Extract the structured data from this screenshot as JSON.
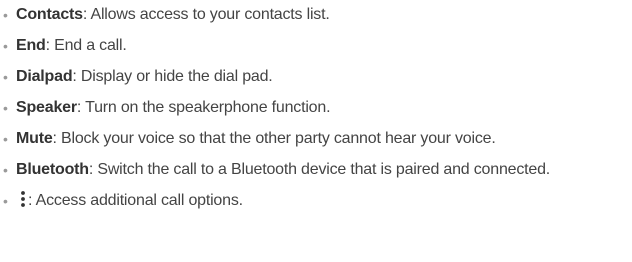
{
  "items": [
    {
      "term": "Contacts",
      "desc": "Allows access to your contacts list."
    },
    {
      "term": "End",
      "desc": "End a call."
    },
    {
      "term": "Dialpad",
      "desc": "Display or hide the dial pad."
    },
    {
      "term": "Speaker",
      "desc": "Turn on the speakerphone function."
    },
    {
      "term": "Mute",
      "desc": "Block your voice so that the other party cannot hear your voice."
    },
    {
      "term": "Bluetooth",
      "desc": "Switch the call to a Bluetooth device that is paired and connected."
    },
    {
      "icon": "more-options-vertical-icon",
      "desc": "Access additional call options."
    }
  ],
  "bullet_char": "•",
  "separator": ":"
}
